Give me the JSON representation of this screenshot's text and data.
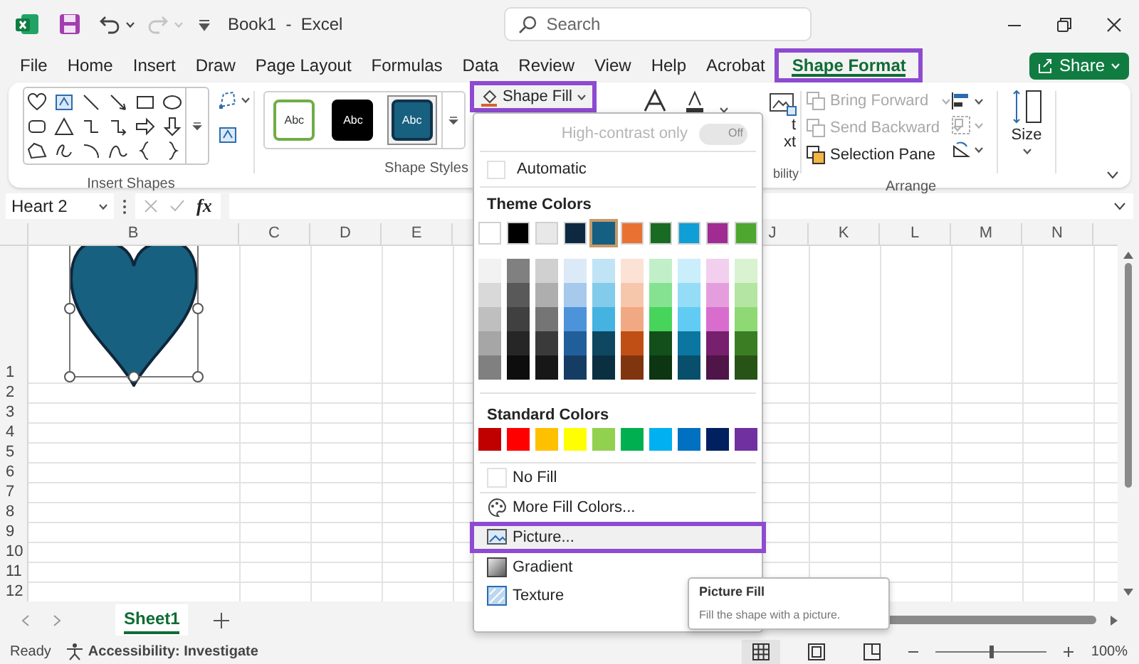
{
  "title_bar": {
    "document_title": "Book1  -  Excel",
    "search": {
      "placeholder": "Search"
    },
    "undo": {
      "disabled": false
    },
    "redo": {
      "disabled": true
    }
  },
  "tabs": [
    {
      "label": "File",
      "selected": false,
      "highlighted": false
    },
    {
      "label": "Home",
      "selected": false,
      "highlighted": false
    },
    {
      "label": "Insert",
      "selected": false,
      "highlighted": false
    },
    {
      "label": "Draw",
      "selected": false,
      "highlighted": false
    },
    {
      "label": "Page Layout",
      "selected": false,
      "highlighted": false
    },
    {
      "label": "Formulas",
      "selected": false,
      "highlighted": false
    },
    {
      "label": "Data",
      "selected": false,
      "highlighted": false
    },
    {
      "label": "Review",
      "selected": false,
      "highlighted": false
    },
    {
      "label": "View",
      "selected": false,
      "highlighted": false
    },
    {
      "label": "Help",
      "selected": false,
      "highlighted": false
    },
    {
      "label": "Acrobat",
      "selected": false,
      "highlighted": false
    },
    {
      "label": "Shape Format",
      "selected": true,
      "highlighted": true
    }
  ],
  "share_button": {
    "label": "Share"
  },
  "ribbon": {
    "insert_shapes": {
      "label": "Insert Shapes"
    },
    "shape_styles": {
      "label": "Shape Styles",
      "presets": [
        {
          "label": "Abc",
          "kind": "outlined",
          "selected": false
        },
        {
          "label": "Abc",
          "kind": "dark",
          "selected": false
        },
        {
          "label": "Abc",
          "kind": "filled",
          "selected": true
        }
      ]
    },
    "shape_fill_button": {
      "label": "Shape Fill",
      "highlighted": true
    },
    "alt_text_fragments": [
      "t",
      "xt"
    ],
    "accessibility_group": {
      "label": "bility"
    },
    "arrange": {
      "label": "Arrange",
      "commands": [
        {
          "label": "Bring Forward",
          "disabled": true
        },
        {
          "label": "Send Backward",
          "disabled": true
        },
        {
          "label": "Selection Pane",
          "disabled": false
        }
      ]
    },
    "size_button": {
      "label": "Size"
    }
  },
  "formula_bar": {
    "name_box": "Heart 2",
    "function_label": "fx"
  },
  "sheet": {
    "columns": [
      "B",
      "C",
      "D",
      "E",
      "J",
      "K",
      "L",
      "M",
      "N"
    ],
    "rows": [
      "1",
      "2",
      "3",
      "4",
      "5",
      "6",
      "7",
      "8",
      "9",
      "10",
      "11",
      "12"
    ],
    "shape": {
      "kind": "heart",
      "selected": true
    }
  },
  "fill_menu": {
    "high_contrast": {
      "label": "High-contrast only",
      "toggle_text": "Off",
      "on": false
    },
    "automatic": "Automatic",
    "theme_heading": "Theme Colors",
    "theme_colors": [
      {
        "color": "#ffffff",
        "selected": false
      },
      {
        "color": "#000000",
        "selected": false
      },
      {
        "color": "#e8e8e8",
        "selected": false
      },
      {
        "color": "#0e2841",
        "selected": false
      },
      {
        "color": "#156082",
        "selected": true
      },
      {
        "color": "#e97132",
        "selected": false
      },
      {
        "color": "#196b24",
        "selected": false
      },
      {
        "color": "#0f9ed5",
        "selected": false
      },
      {
        "color": "#a02b93",
        "selected": false
      },
      {
        "color": "#4ea72e",
        "selected": false
      }
    ],
    "theme_shades": [
      {
        "shades": [
          {
            "color": "#f2f2f2"
          },
          {
            "color": "#d9d9d9"
          },
          {
            "color": "#bfbfbf"
          },
          {
            "color": "#a6a6a6"
          },
          {
            "color": "#808080"
          }
        ]
      },
      {
        "shades": [
          {
            "color": "#808080"
          },
          {
            "color": "#595959"
          },
          {
            "color": "#404040"
          },
          {
            "color": "#262626"
          },
          {
            "color": "#0d0d0d"
          }
        ]
      },
      {
        "shades": [
          {
            "color": "#d0d0d0"
          },
          {
            "color": "#aeaeae"
          },
          {
            "color": "#757575"
          },
          {
            "color": "#3a3a3a"
          },
          {
            "color": "#171717"
          }
        ]
      },
      {
        "shades": [
          {
            "color": "#dceaf7"
          },
          {
            "color": "#a6c9ec"
          },
          {
            "color": "#4d93d9"
          },
          {
            "color": "#215f9a"
          },
          {
            "color": "#153d64"
          }
        ]
      },
      {
        "shades": [
          {
            "color": "#c0e4f5"
          },
          {
            "color": "#83cbeb"
          },
          {
            "color": "#44b3e1"
          },
          {
            "color": "#0f4761"
          },
          {
            "color": "#0a2f40"
          }
        ]
      },
      {
        "shades": [
          {
            "color": "#fbe2d5"
          },
          {
            "color": "#f7c7ac"
          },
          {
            "color": "#f1a983"
          },
          {
            "color": "#c04f15"
          },
          {
            "color": "#80350e"
          }
        ]
      },
      {
        "shades": [
          {
            "color": "#c1f0c8"
          },
          {
            "color": "#84e291"
          },
          {
            "color": "#47d45a"
          },
          {
            "color": "#124f1a"
          },
          {
            "color": "#0c3512"
          }
        ]
      },
      {
        "shades": [
          {
            "color": "#caeefb"
          },
          {
            "color": "#95dcf7"
          },
          {
            "color": "#61cbf3"
          },
          {
            "color": "#0b76a0"
          },
          {
            "color": "#074f6a"
          }
        ]
      },
      {
        "shades": [
          {
            "color": "#f2cfee"
          },
          {
            "color": "#e59edd"
          },
          {
            "color": "#d86dcd"
          },
          {
            "color": "#77206d"
          },
          {
            "color": "#4f1548"
          }
        ]
      },
      {
        "shades": [
          {
            "color": "#d9f2d0"
          },
          {
            "color": "#b4e5a2"
          },
          {
            "color": "#8ed973"
          },
          {
            "color": "#3b7d23"
          },
          {
            "color": "#275317"
          }
        ]
      }
    ],
    "standard_heading": "Standard Colors",
    "standard_colors": [
      {
        "color": "#c00000"
      },
      {
        "color": "#ff0000"
      },
      {
        "color": "#ffc000"
      },
      {
        "color": "#ffff00"
      },
      {
        "color": "#92d050"
      },
      {
        "color": "#00b050"
      },
      {
        "color": "#00b0f0"
      },
      {
        "color": "#0070c0"
      },
      {
        "color": "#002060"
      },
      {
        "color": "#7030a0"
      }
    ],
    "items": [
      {
        "kind": "no_fill",
        "label": "No Fill",
        "highlighted": false
      },
      {
        "kind": "more_colors",
        "label": "More Fill Colors...",
        "highlighted": false
      },
      {
        "kind": "picture",
        "label": "Picture...",
        "highlighted": true
      },
      {
        "kind": "gradient",
        "label": "Gradient",
        "highlighted": false
      },
      {
        "kind": "texture",
        "label": "Texture",
        "highlighted": false
      }
    ]
  },
  "tooltip": {
    "title": "Picture Fill",
    "description": "Fill the shape with a picture."
  },
  "sheet_tabs": [
    {
      "label": "Sheet1",
      "selected": true
    }
  ],
  "status_bar": {
    "ready": "Ready",
    "accessibility": "Accessibility: Investigate",
    "views": [
      {
        "kind": "normal",
        "selected": true
      },
      {
        "kind": "page_layout",
        "selected": false
      },
      {
        "kind": "page_break",
        "selected": false
      }
    ],
    "zoom": {
      "level": 0.5,
      "reading": "100%"
    }
  }
}
